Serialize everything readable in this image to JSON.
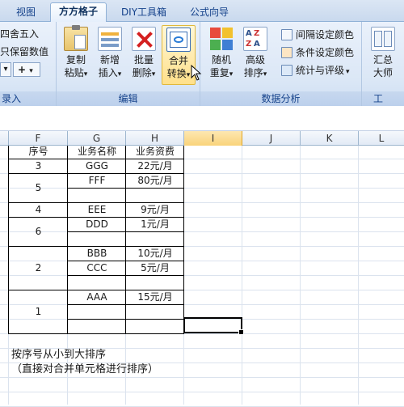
{
  "tabs": [
    "视图",
    "方方格子",
    "DIY工具箱",
    "公式向导"
  ],
  "ribbon": {
    "left_group": {
      "label": "录入",
      "items": [
        "四舍五入",
        "只保留数值"
      ],
      "plus": "+"
    },
    "edit_group": {
      "label": "编辑",
      "buttons": [
        {
          "line1": "复制",
          "line2": "粘贴"
        },
        {
          "line1": "新增",
          "line2": "插入"
        },
        {
          "line1": "批量",
          "line2": "删除"
        },
        {
          "line1": "合并",
          "line2": "转换"
        }
      ]
    },
    "analysis_group": {
      "label": "数据分析",
      "buttons": [
        {
          "line1": "随机",
          "line2": "重复"
        },
        {
          "line1": "高级",
          "line2": "排序"
        }
      ],
      "small": [
        "间隔设定颜色",
        "条件设定颜色",
        "统计与评级"
      ]
    },
    "right_group": {
      "label": "工",
      "button": {
        "line1": "汇总",
        "line2": "大师"
      }
    },
    "dropdown_glyph": "▾"
  },
  "columns": [
    "F",
    "G",
    "H",
    "I",
    "J",
    "K",
    "L"
  ],
  "table": {
    "headers": [
      "序号",
      "业务名称",
      "业务资费"
    ],
    "groups": [
      {
        "seq": "3",
        "rows": [
          [
            "GGG",
            "22元/月"
          ]
        ]
      },
      {
        "seq": "5",
        "rows": [
          [
            "FFF",
            "80元/月"
          ],
          [
            "",
            ""
          ]
        ]
      },
      {
        "seq": "4",
        "rows": [
          [
            "EEE",
            "9元/月"
          ]
        ]
      },
      {
        "seq": "6",
        "rows": [
          [
            "DDD",
            "1元/月"
          ],
          [
            "",
            ""
          ]
        ]
      },
      {
        "seq": "2",
        "rows": [
          [
            "BBB",
            "10元/月"
          ],
          [
            "CCC",
            "5元/月"
          ],
          [
            "",
            ""
          ]
        ]
      },
      {
        "seq": "1",
        "rows": [
          [
            "AAA",
            "15元/月"
          ],
          [
            "",
            ""
          ],
          [
            "",
            ""
          ]
        ]
      }
    ]
  },
  "notes": [
    "按序号从小到大排序",
    "（直接对合并单元格进行排序）"
  ]
}
